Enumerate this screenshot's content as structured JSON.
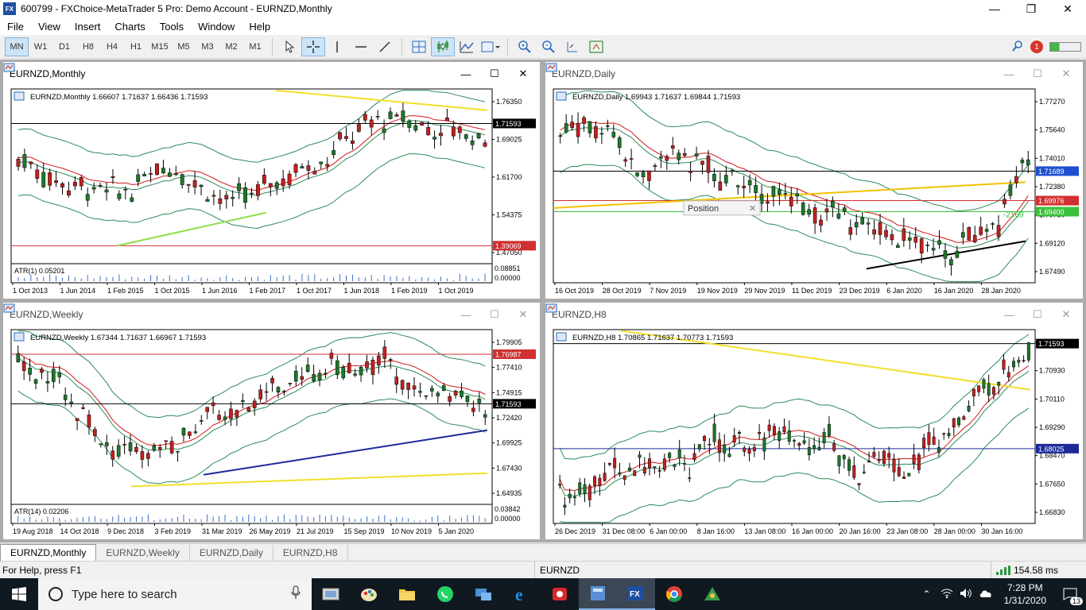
{
  "window": {
    "title": "600799 - FXChoice-MetaTrader 5 Pro: Demo Account - EURNZD,Monthly",
    "app_icon_text": "FX",
    "minimize": "—",
    "maximize": "❐",
    "close": "✕"
  },
  "menu": [
    "File",
    "View",
    "Insert",
    "Charts",
    "Tools",
    "Window",
    "Help"
  ],
  "toolbar": {
    "timeframes": [
      "MN",
      "W1",
      "D1",
      "H8",
      "H4",
      "H1",
      "M15",
      "M5",
      "M3",
      "M2",
      "M1"
    ],
    "active_timeframe": "MN",
    "notification_count": "1"
  },
  "charts": {
    "monthly": {
      "window_title": "EURNZD,Monthly",
      "header": "EURNZD,Monthly  1.66607 1.71637 1.66436 1.71593",
      "prices": [
        "1.76350",
        "1.69025",
        "1.61700",
        "1.54375",
        "1.47050"
      ],
      "current_price": "1.71593",
      "red_line_price": "1.39069",
      "indicator": "ATR(1) 0.05201",
      "indicator_scale": [
        "0.08851",
        "0.00000"
      ],
      "dates": [
        "1 Oct 2013",
        "1 Jun 2014",
        "1 Feb 2015",
        "1 Oct 2015",
        "1 Jun 2016",
        "1 Feb 2017",
        "1 Oct 2017",
        "1 Jun 2018",
        "1 Feb 2019",
        "1 Oct 2019"
      ]
    },
    "daily": {
      "window_title": "EURNZD,Daily",
      "header": "EURNZD,Daily  1.69943 1.71637 1.69844 1.71593",
      "prices": [
        "1.77270",
        "1.75640",
        "1.74010",
        "1.72380",
        "1.70750",
        "1.69120",
        "1.67490"
      ],
      "current_price": "1.71689",
      "red_price": "1.69976",
      "green_price": "1.69400",
      "green_label": "-2169",
      "tooltip": "Position",
      "dates": [
        "16 Oct 2019",
        "28 Oct 2019",
        "7 Nov 2019",
        "19 Nov 2019",
        "29 Nov 2019",
        "11 Dec 2019",
        "23 Dec 2019",
        "6 Jan 2020",
        "16 Jan 2020",
        "28 Jan 2020"
      ]
    },
    "weekly": {
      "window_title": "EURNZD,Weekly",
      "header": "EURNZD,Weekly  1.67344 1.71637 1.66967 1.71593",
      "prices": [
        "1.79905",
        "1.77410",
        "1.74915",
        "1.72420",
        "1.69925",
        "1.67430",
        "1.64935"
      ],
      "current_price": "1.71593",
      "red_line_price": "1.76987",
      "indicator": "ATR(14) 0.02206",
      "indicator_scale": [
        "0.03842",
        "0.00000"
      ],
      "dates": [
        "19 Aug 2018",
        "14 Oct 2018",
        "9 Dec 2018",
        "3 Feb 2019",
        "31 Mar 2019",
        "26 May 2019",
        "21 Jul 2019",
        "15 Sep 2019",
        "10 Nov 2019",
        "5 Jan 2020"
      ]
    },
    "h8": {
      "window_title": "EURNZD,H8",
      "header": "EURNZD,H8  1.70865 1.71637 1.70773 1.71593",
      "prices": [
        "1.71750",
        "1.70930",
        "1.70110",
        "1.69290",
        "1.68470",
        "1.67650",
        "1.66830"
      ],
      "current_price": "1.71593",
      "blue_line_price": "1.68025",
      "dates": [
        "26 Dec 2019",
        "31 Dec 08:00",
        "6 Jan 00:00",
        "8 Jan 16:00",
        "13 Jan 08:00",
        "16 Jan 00:00",
        "20 Jan 16:00",
        "23 Jan 08:00",
        "28 Jan 00:00",
        "30 Jan 16:00"
      ]
    }
  },
  "tabs": [
    "EURNZD,Monthly",
    "EURNZD,Weekly",
    "EURNZD,Daily",
    "EURNZD,H8"
  ],
  "status": {
    "help": "For Help, press F1",
    "symbol": "EURNZD",
    "ping": "154.58 ms"
  },
  "taskbar": {
    "search_placeholder": "Type here to search",
    "time": "7:28 PM",
    "date": "1/31/2020",
    "notifications": "13"
  },
  "colors": {
    "bull_candle": "#1b7a2a",
    "bear_candle": "#c42020",
    "bollinger": "#2e8b57",
    "moving_average": "#d01818",
    "trend_yellow": "#f2e02a",
    "trend_green": "#8fe04a",
    "selected_toolbar": "#cde4f7"
  }
}
